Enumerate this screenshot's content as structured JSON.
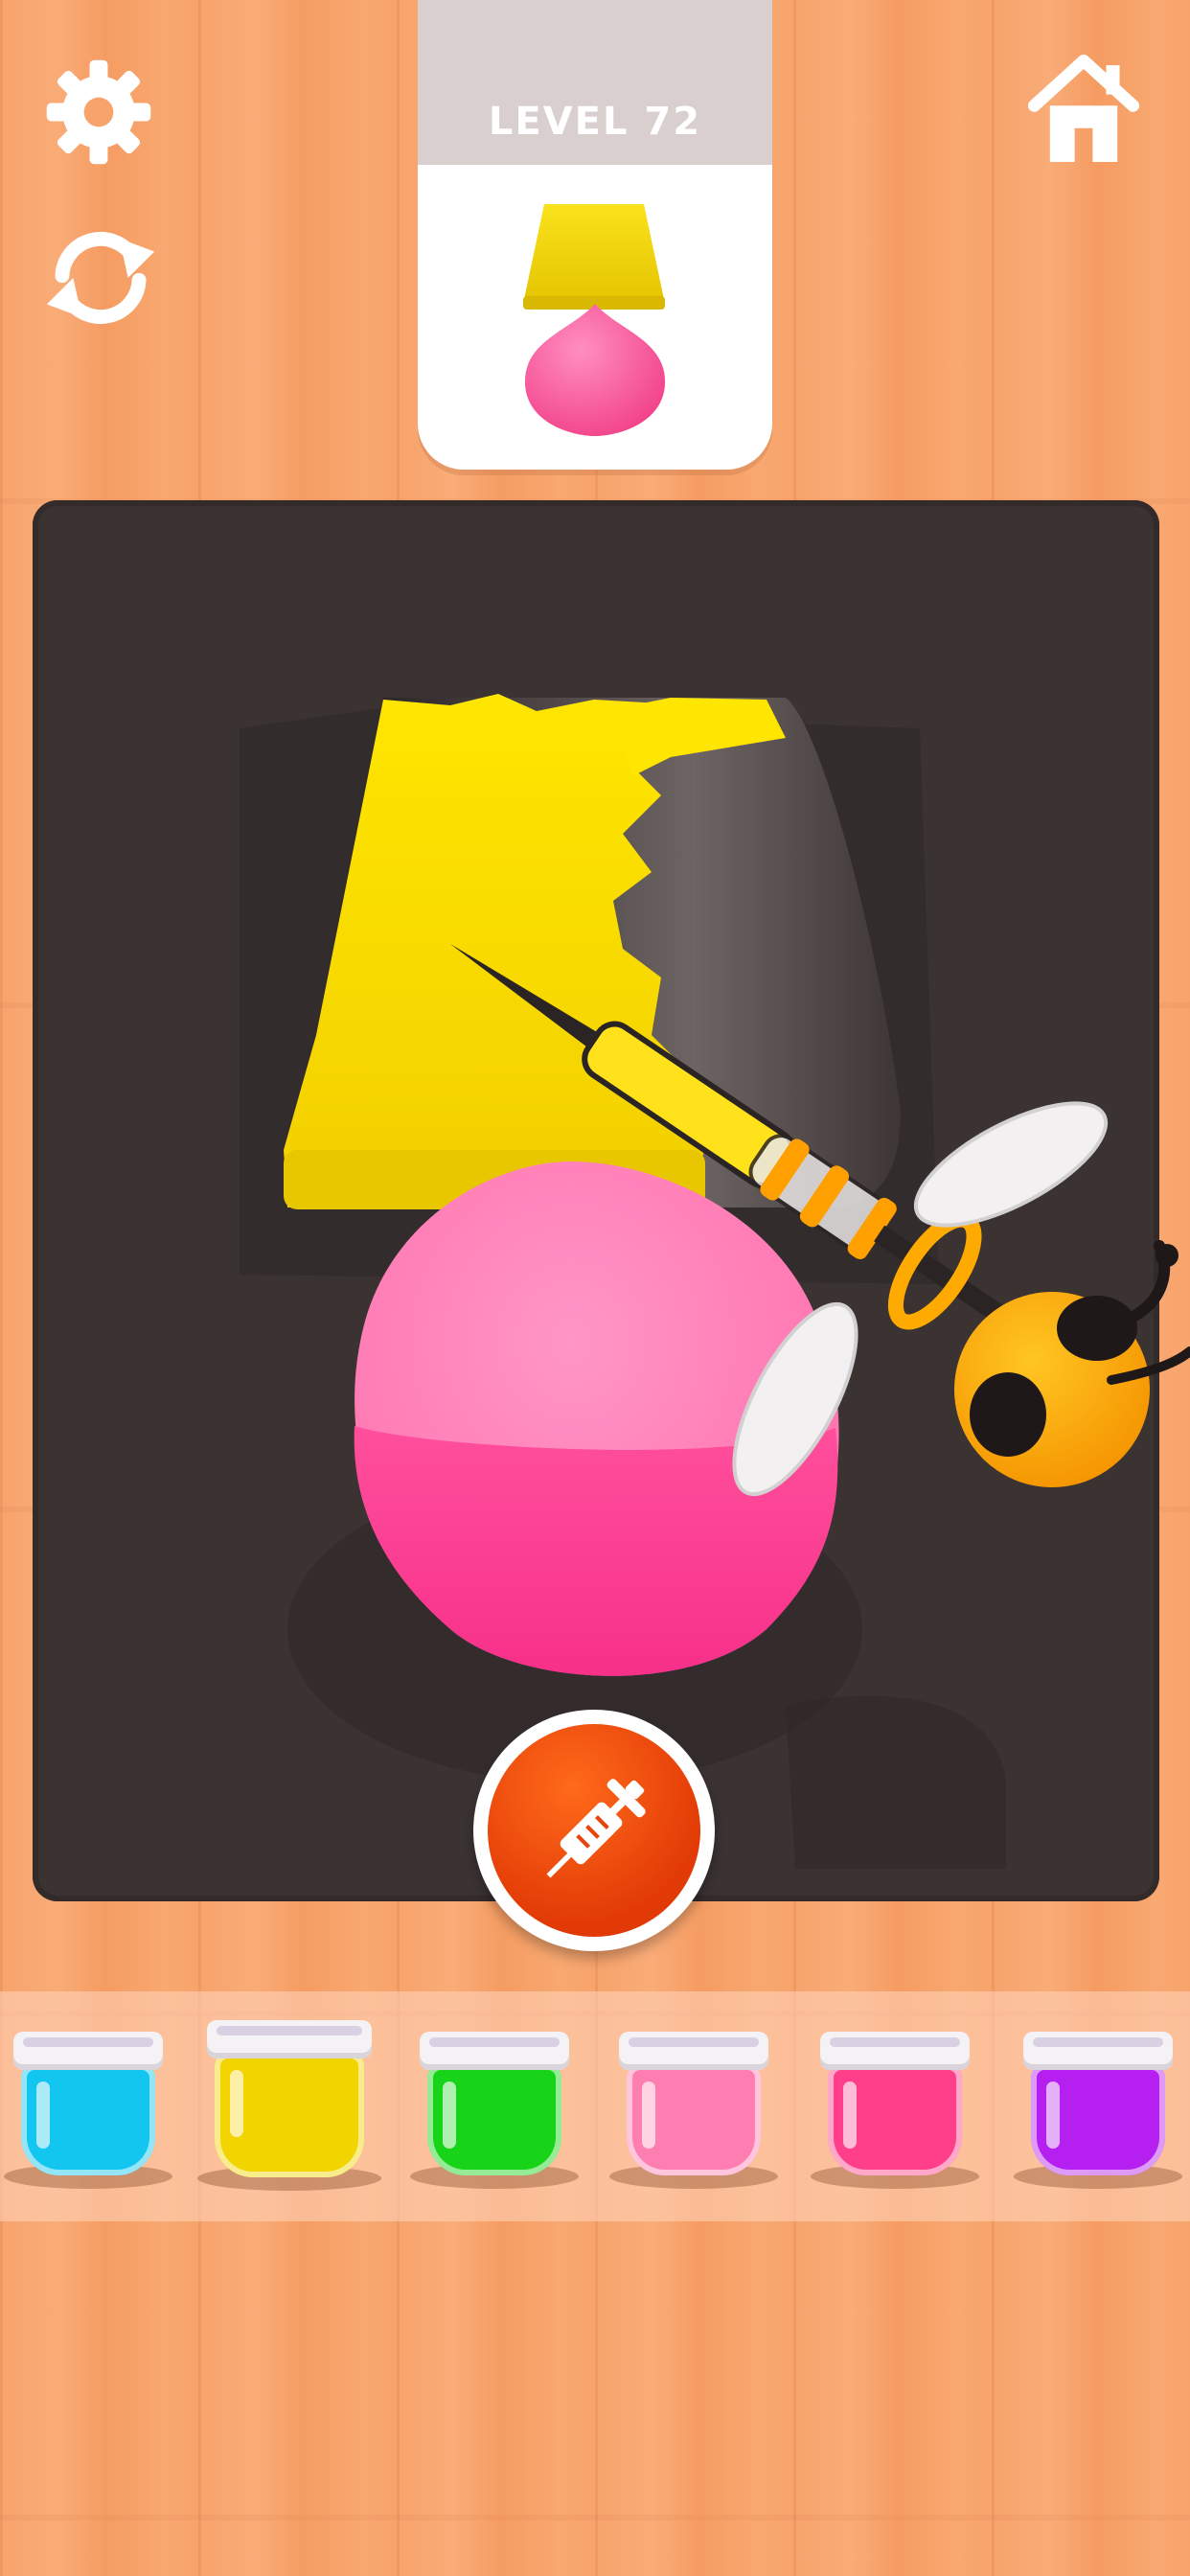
{
  "header": {
    "level_label": "LEVEL 72"
  },
  "icons": {
    "settings": "gear-icon",
    "restart": "refresh-icon",
    "home": "home-icon",
    "fill": "syringe-icon"
  },
  "target": {
    "top_color": "#f7d90a",
    "bottom_color": "#ff5fa2"
  },
  "paint_jars": [
    {
      "name": "cyan",
      "color": "#12c6ef"
    },
    {
      "name": "yellow",
      "color": "#f2d400"
    },
    {
      "name": "green",
      "color": "#18d418"
    },
    {
      "name": "light-pink",
      "color": "#ff7eb1"
    },
    {
      "name": "pink",
      "color": "#ff3f8a"
    },
    {
      "name": "purple",
      "color": "#b51ff0"
    }
  ],
  "colors": {
    "board": "#3b3232",
    "fill_button": "#e8430a",
    "background": "#f7a36c"
  }
}
